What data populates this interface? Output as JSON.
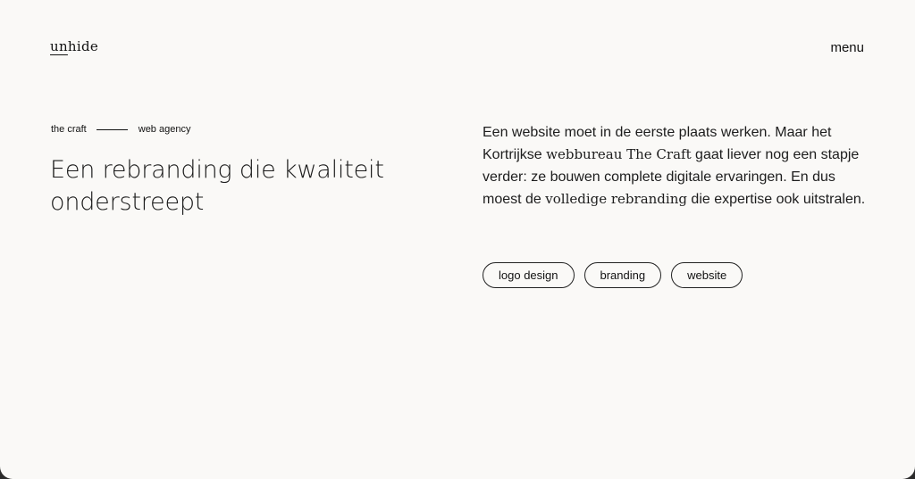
{
  "header": {
    "logo_pre": "un",
    "logo_post": "hide",
    "menu_label": "menu"
  },
  "hero": {
    "client": "the craft",
    "category": "web agency",
    "title": "Een rebranding die kwaliteit onderstreept"
  },
  "intro": {
    "p1": "Een website moet in de eerste plaats werken. Maar het Kortrijkse ",
    "highlight1": "webbureau The Craft",
    "p2": " gaat liever nog een stapje verder: ze bouwen complete digitale ervaringen. En dus moest de ",
    "highlight2": "volledige rebranding",
    "p3": " die expertise ook uitstralen."
  },
  "tags": [
    "logo design",
    "branding",
    "website"
  ]
}
